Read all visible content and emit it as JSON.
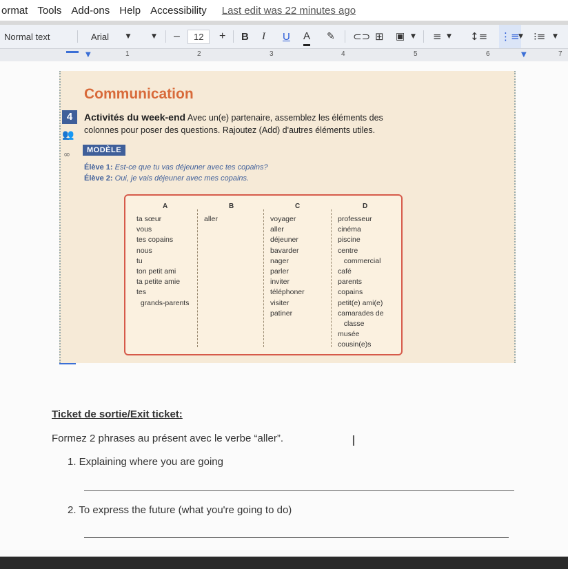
{
  "menu": {
    "items": [
      "ormat",
      "Tools",
      "Add-ons",
      "Help",
      "Accessibility"
    ],
    "last_edit": "Last edit was 22 minutes ago"
  },
  "toolbar": {
    "style": "Normal text",
    "font": "Arial",
    "font_size": "12",
    "minus": "–",
    "plus": "+",
    "bold": "B",
    "italic": "I",
    "underline": "U",
    "text_color": "A"
  },
  "ruler": {
    "marks": [
      "1",
      "2",
      "3",
      "4",
      "5",
      "6",
      "7"
    ]
  },
  "textbook": {
    "heading": "Communication",
    "activity_number": "4",
    "activity_title": "Activités du week-end",
    "activity_text_1": " Avec un(e) partenaire, assemblez les éléments des",
    "activity_text_2": "colonnes pour poser des questions. Rajoutez (Add) d'autres éléments utiles.",
    "modele_label": "MODÈLE",
    "eleve1_label": "Élève 1:",
    "eleve1_text": " Est-ce que tu vas déjeuner avec tes copains?",
    "eleve2_label": "Élève 2:",
    "eleve2_text": " Oui, je vais déjeuner avec mes copains.",
    "table": {
      "headers": [
        "A",
        "B",
        "C",
        "D"
      ],
      "col_a": "ta sœur\nvous\ntes copains\nnous\ntu\nton petit ami\nta petite amie\ntes\n  grands-parents",
      "col_b": "aller",
      "col_c": "voyager\naller\ndéjeuner\nbavarder\nnager\nparler\ninviter\ntéléphoner\nvisiter\npatiner",
      "col_d": "professeur\ncinéma\npiscine\ncentre\n   commercial\ncafé\nparents\ncopains\npetit(e) ami(e)\ncamarades de\n   classe\nmusée\ncousin(e)s"
    }
  },
  "document": {
    "exit_title": "Ticket de sortie/Exit ticket:",
    "instruction": "Formez 2 phrases au présent avec le verbe “aller”.",
    "q1": "1.  Explaining where you are going",
    "q2": "2. To express the future (what you're going to do)"
  },
  "colors": {
    "heading": "#d86a3a",
    "accent": "#3f5f9a",
    "table_border": "#d65a4a"
  }
}
